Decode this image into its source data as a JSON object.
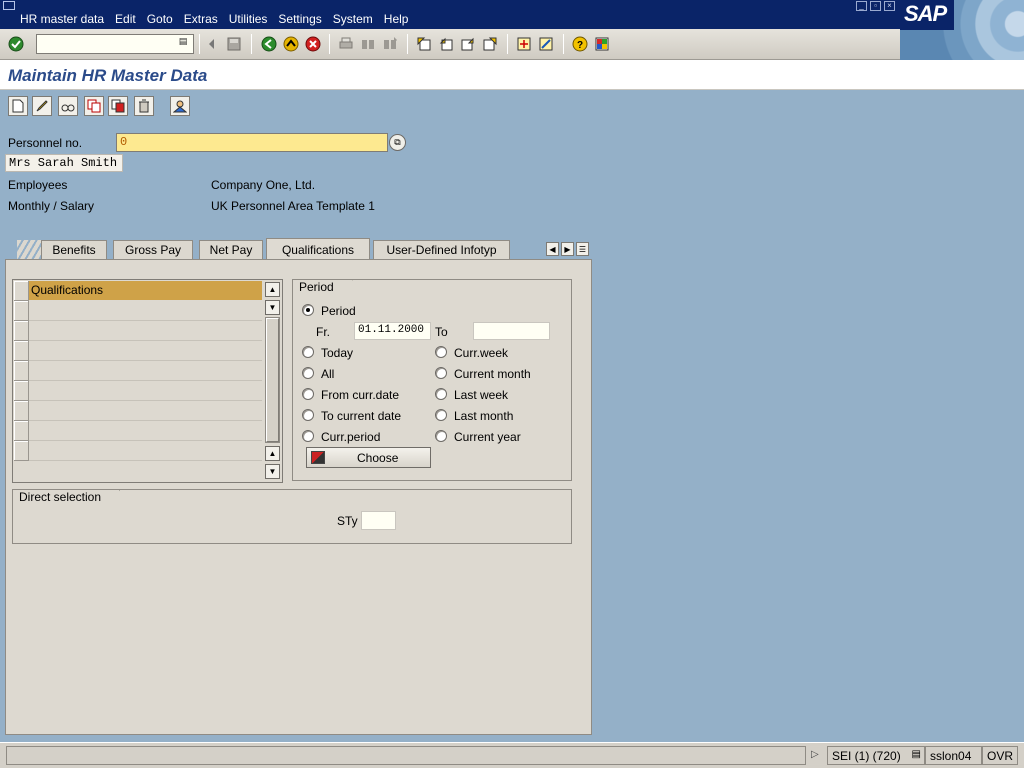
{
  "menubar": {
    "items": [
      "HR master data",
      "Edit",
      "Goto",
      "Extras",
      "Utilities",
      "Settings",
      "System",
      "Help"
    ],
    "logo": "SAP"
  },
  "toolbar": {
    "command_value": "",
    "icons": [
      "enter-icon",
      "back-nav-icon",
      "save-icon",
      "back-icon",
      "exit-icon",
      "cancel-icon",
      "print-icon",
      "find-icon",
      "find-next-icon",
      "first-page-icon",
      "previous-page-icon",
      "next-page-icon",
      "last-page-icon",
      "new-session-icon",
      "shortcut-icon",
      "help-icon",
      "layout-icon"
    ]
  },
  "title": "Maintain HR Master Data",
  "app_toolbar": {
    "icons": [
      "create-icon",
      "change-icon",
      "display-icon",
      "copy-icon",
      "delimit-icon",
      "delete-icon",
      "search-person-icon"
    ]
  },
  "header": {
    "personnel_label": "Personnel no.",
    "personnel_value": "0",
    "employee_name": "Mrs Sarah Smith",
    "emp_group_label": "Employees",
    "emp_group_value": "Company One, Ltd.",
    "payroll_label": "Monthly / Salary",
    "payroll_value": "UK Personnel Area Template 1"
  },
  "tabs": [
    {
      "label": "Benefits",
      "active": false
    },
    {
      "label": "Gross Pay",
      "active": false
    },
    {
      "label": "Net Pay",
      "active": false
    },
    {
      "label": "Qualifications",
      "active": true
    },
    {
      "label": "User-Defined Infotyp",
      "active": false
    }
  ],
  "infotype_list": {
    "header": "Qualifications",
    "rows": 9
  },
  "period": {
    "title": "Period",
    "period_option": "Period",
    "from_label": "Fr.",
    "from_value": "01.11.2000",
    "to_label": "To",
    "to_value": "",
    "left_options": [
      "Today",
      "All",
      "From curr.date",
      "To current date",
      "Curr.period"
    ],
    "right_options": [
      "Curr.week",
      "Current month",
      "Last week",
      "Last month",
      "Current year"
    ],
    "selected": "Period",
    "choose_label": "Choose"
  },
  "direct_selection": {
    "title": "Direct selection",
    "sty_label": "STy",
    "sty_value": ""
  },
  "statusbar": {
    "message": "",
    "session": "SEI (1) (720)",
    "server": "sslon04",
    "mode": "OVR"
  },
  "colors": {
    "menubar": "#0a2468",
    "background": "#94b0c8",
    "panel": "#ddd9d0",
    "required_field": "#fde990",
    "selected_row": "#cfa248",
    "title": "#2b4b8a"
  }
}
